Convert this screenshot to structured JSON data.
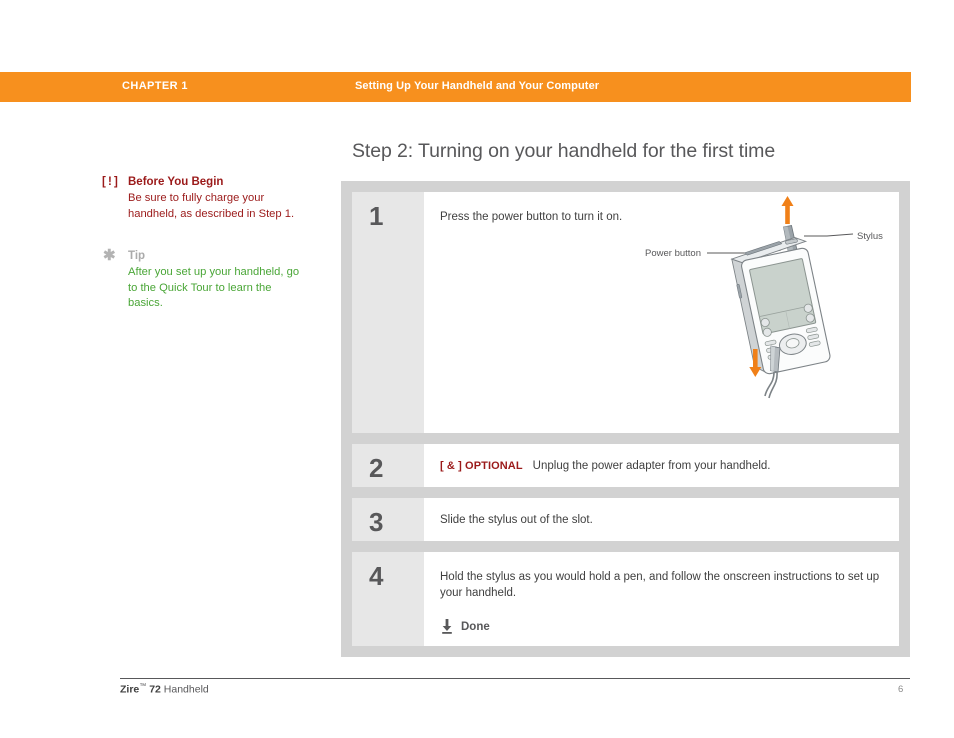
{
  "header": {
    "chapter_label": "CHAPTER 1",
    "chapter_title": "Setting Up Your Handheld and Your Computer",
    "bar_color": "#f7901e"
  },
  "sidebar": {
    "notes": [
      {
        "icon": "[ ! ]",
        "icon_name": "alert-icon",
        "heading": "Before You Begin",
        "text": "Be sure to fully charge your handheld, as described in Step 1.",
        "color": "#9b1a1a"
      },
      {
        "icon": "✱",
        "icon_name": "asterisk-icon",
        "heading": "Tip",
        "text": "After you set up your handheld, go to the Quick Tour to learn the basics.",
        "color": "#4aa637"
      }
    ]
  },
  "main": {
    "page_title": "Step 2: Turning on your handheld for the first time",
    "steps": [
      {
        "number": "1",
        "text": "Press the power button to turn it on.",
        "optional_tag": "",
        "done_label": ""
      },
      {
        "number": "2",
        "text": "Unplug the power adapter from your handheld.",
        "optional_tag": "[ & ]  OPTIONAL",
        "done_label": ""
      },
      {
        "number": "3",
        "text": "Slide the stylus out of the slot.",
        "optional_tag": "",
        "done_label": ""
      },
      {
        "number": "4",
        "text": "Hold the stylus as you would hold a pen, and follow the onscreen instructions to set up your handheld.",
        "optional_tag": "",
        "done_label": "Done"
      }
    ],
    "illustration": {
      "callouts": [
        {
          "label": "Stylus",
          "name": "stylus-callout"
        },
        {
          "label": "Power button",
          "name": "power-button-callout"
        }
      ],
      "arrow_color": "#f08018",
      "device_name": "palm-handheld-device"
    }
  },
  "footer": {
    "product_bold": "Zire",
    "product_tm": "™",
    "product_model": "72",
    "product_rest": "Handheld",
    "page_number": "6"
  }
}
